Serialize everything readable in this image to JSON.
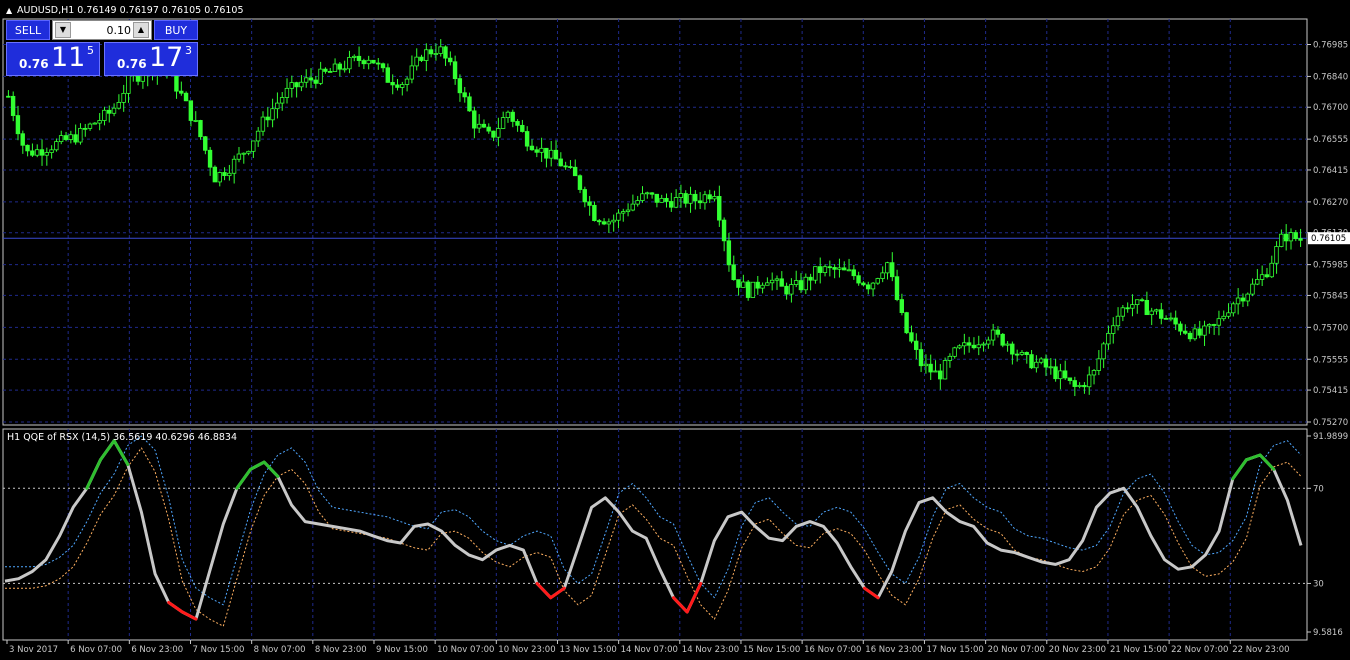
{
  "chart_title": "AUDUSD,H1  0.76149 0.76197 0.76105 0.76105",
  "indicator_title": "H1 QQE of RSX (14,5) 36.5619 40.6296 46.8834",
  "trade_panel": {
    "sell_label": "SELL",
    "buy_label": "BUY",
    "lot_value": "0.10",
    "sell_prefix": "0.76",
    "sell_big": "11",
    "sell_sup": "5",
    "buy_prefix": "0.76",
    "buy_big": "17",
    "buy_sup": "3",
    "down_arrow": "▼",
    "up_arrow": "▲"
  },
  "price_axis": {
    "ticks": [
      "0.76985",
      "0.76840",
      "0.76700",
      "0.76555",
      "0.76415",
      "0.76270",
      "0.76130",
      "0.75985",
      "0.75845",
      "0.75700",
      "0.75555",
      "0.75415",
      "0.75270"
    ],
    "current_price": "0.76105"
  },
  "indicator_axis": {
    "ticks": [
      "91.9899",
      "70",
      "30",
      "9.5816"
    ]
  },
  "time_axis": {
    "labels": [
      "3 Nov 2017",
      "6 Nov 07:00",
      "6 Nov 23:00",
      "7 Nov 15:00",
      "8 Nov 07:00",
      "8 Nov 23:00",
      "9 Nov 15:00",
      "10 Nov 07:00",
      "10 Nov 23:00",
      "13 Nov 15:00",
      "14 Nov 07:00",
      "14 Nov 23:00",
      "15 Nov 15:00",
      "16 Nov 07:00",
      "16 Nov 23:00",
      "17 Nov 15:00",
      "20 Nov 07:00",
      "20 Nov 23:00",
      "21 Nov 15:00",
      "22 Nov 07:00",
      "22 Nov 23:00"
    ]
  },
  "colors": {
    "background": "#000000",
    "candle": "#32ff32",
    "grid": "#1f2a8c",
    "axis": "#c8c8c8",
    "qqe_line": "#c8c8c8",
    "qqe_overbought": "#2fbf2f",
    "qqe_oversold": "#ff1a1a",
    "signal_upper": "#4fa7ff",
    "signal_lower": "#ffb060",
    "panel_button": "#1f2ddb"
  },
  "chart_data": [
    {
      "type": "candlestick",
      "title": "AUDUSD,H1",
      "ylim": [
        0.7527,
        0.7706
      ],
      "close_profile": [
        0.7675,
        0.7649,
        0.7651,
        0.7654,
        0.7657,
        0.7663,
        0.7668,
        0.7682,
        0.7687,
        0.769,
        0.7676,
        0.766,
        0.7638,
        0.7644,
        0.7653,
        0.7666,
        0.7676,
        0.7681,
        0.7684,
        0.7687,
        0.7691,
        0.7693,
        0.7683,
        0.7681,
        0.7694,
        0.7697,
        0.7683,
        0.7663,
        0.7656,
        0.7668,
        0.7656,
        0.765,
        0.7645,
        0.7637,
        0.7621,
        0.7618,
        0.7625,
        0.763,
        0.7627,
        0.7628,
        0.7628,
        0.7632,
        0.7593,
        0.7586,
        0.7593,
        0.7587,
        0.7589,
        0.7596,
        0.7596,
        0.7594,
        0.7589,
        0.76,
        0.757,
        0.7553,
        0.7548,
        0.7559,
        0.7563,
        0.7567,
        0.7563,
        0.7555,
        0.7553,
        0.7548,
        0.7542,
        0.7549,
        0.7572,
        0.7581,
        0.7579,
        0.7575,
        0.757,
        0.7566,
        0.757,
        0.7581,
        0.7587,
        0.7595,
        0.7612,
        0.761
      ],
      "last_price": 0.76105
    },
    {
      "type": "line",
      "title": "H1 QQE of RSX (14,5)",
      "ylim": [
        9.5816,
        91.9899
      ],
      "levels": [
        70,
        30
      ],
      "series": [
        {
          "name": "QQE",
          "values": [
            31,
            32,
            35,
            40,
            50,
            62,
            70,
            82,
            90,
            80,
            60,
            34,
            22,
            18,
            15,
            35,
            55,
            70,
            78,
            81,
            75,
            63,
            56,
            55,
            54,
            53,
            52,
            50,
            48,
            47,
            54,
            55,
            52,
            46,
            42,
            40,
            44,
            46,
            44,
            30,
            24,
            28,
            45,
            62,
            66,
            60,
            52,
            49,
            36,
            24,
            18,
            30,
            48,
            58,
            60,
            54,
            49,
            48,
            54,
            56,
            54,
            47,
            37,
            28,
            24,
            35,
            52,
            64,
            66,
            60,
            56,
            54,
            47,
            44,
            43,
            41,
            39,
            38,
            40,
            48,
            62,
            68,
            70,
            62,
            50,
            40,
            36,
            37,
            42,
            52,
            74,
            82,
            84,
            78,
            65,
            46
          ]
        }
      ]
    }
  ]
}
